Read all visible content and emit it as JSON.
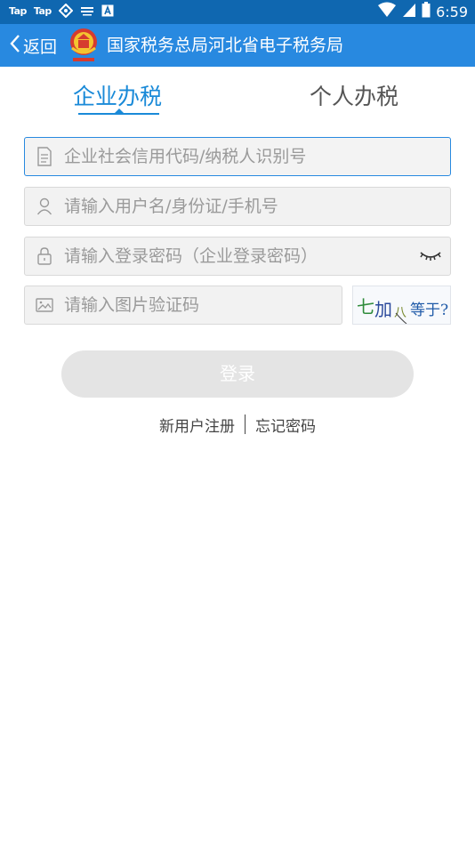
{
  "status_bar": {
    "left_labels": [
      "Tap",
      "Tap"
    ],
    "time": "6:59",
    "icons": [
      "tap-app-icon",
      "tap-app-icon",
      "vpn-icon",
      "keyboard-icon",
      "a-app-icon",
      "wifi-icon",
      "signal-icon",
      "battery-icon"
    ]
  },
  "header": {
    "back_label": "返回",
    "title": "国家税务总局河北省电子税务局",
    "emblem_icon": "tax-emblem-icon"
  },
  "tabs": [
    {
      "label": "企业办税",
      "active": true
    },
    {
      "label": "个人办税",
      "active": false
    }
  ],
  "form": {
    "credit_code": {
      "placeholder": "企业社会信用代码/纳税人识别号",
      "value": "",
      "icon": "document-icon"
    },
    "username": {
      "placeholder": "请输入用户名/身份证/手机号",
      "value": "",
      "icon": "user-icon"
    },
    "password": {
      "placeholder": "请输入登录密码（企业登录密码）",
      "value": "",
      "icon": "lock-icon",
      "toggle_icon": "eye-closed-icon"
    },
    "captcha": {
      "placeholder": "请输入图片验证码",
      "value": "",
      "icon": "image-icon",
      "image_text": [
        "七",
        "加",
        "八",
        "等于?"
      ]
    }
  },
  "login_button": "登录",
  "links": {
    "register": "新用户注册",
    "forgot": "忘记密码"
  },
  "colors": {
    "status_bar": "#0f67b0",
    "title_bar": "#2889e0",
    "accent": "#1a8ad8",
    "button_disabled": "#e4e4e4"
  }
}
